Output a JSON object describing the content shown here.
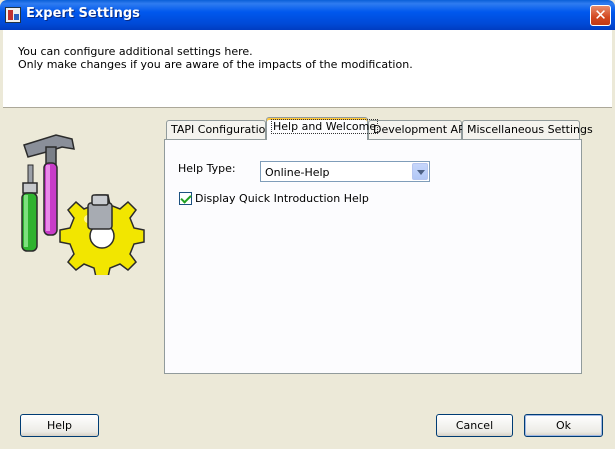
{
  "window": {
    "title": "Expert Settings",
    "close_glyph": "✕"
  },
  "header": {
    "line1": "You can configure additional settings here.",
    "line2": "Only make changes if you are aware of the impacts of the modification."
  },
  "tabs": [
    {
      "label": "TAPI Configuration",
      "active": false
    },
    {
      "label": "Help and Welcome",
      "active": true
    },
    {
      "label": "Development API",
      "active": false
    },
    {
      "label": "Miscellaneous Settings",
      "active": false
    }
  ],
  "help_tab": {
    "help_type_label": "Help Type:",
    "help_type_value": "Online-Help",
    "quick_intro_label": "Display Quick Introduction Help",
    "quick_intro_checked": true
  },
  "buttons": {
    "help": "Help",
    "cancel": "Cancel",
    "ok": "Ok"
  },
  "icons": {
    "window_icon": "application-icon",
    "art": "tools-gear-icon"
  }
}
